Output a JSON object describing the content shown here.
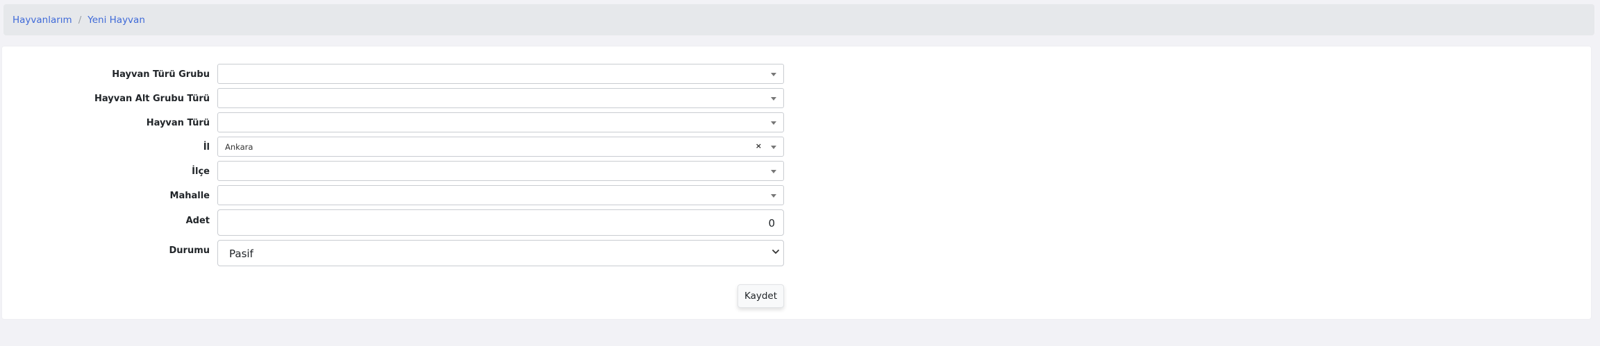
{
  "breadcrumb": {
    "items": [
      "Hayvanlarım",
      "Yeni Hayvan"
    ],
    "separator": "/"
  },
  "form": {
    "fields": {
      "hayvan_turu_grubu": {
        "label": "Hayvan Türü Grubu",
        "value": ""
      },
      "hayvan_alt_grubu_turu": {
        "label": "Hayvan Alt Grubu Türü",
        "value": ""
      },
      "hayvan_turu": {
        "label": "Hayvan Türü",
        "value": ""
      },
      "il": {
        "label": "İl",
        "value": "Ankara",
        "clear_icon": "×"
      },
      "ilce": {
        "label": "İlçe",
        "value": ""
      },
      "mahalle": {
        "label": "Mahalle",
        "value": ""
      },
      "adet": {
        "label": "Adet",
        "value": "0"
      },
      "durumu": {
        "label": "Durumu",
        "value": "Pasif"
      }
    },
    "save_label": "Kaydet"
  },
  "colors": {
    "link": "#3f6ad8",
    "breadcrumb_bg": "#e6e8eb",
    "page_bg": "#f2f2f6",
    "card_bg": "#ffffff"
  }
}
